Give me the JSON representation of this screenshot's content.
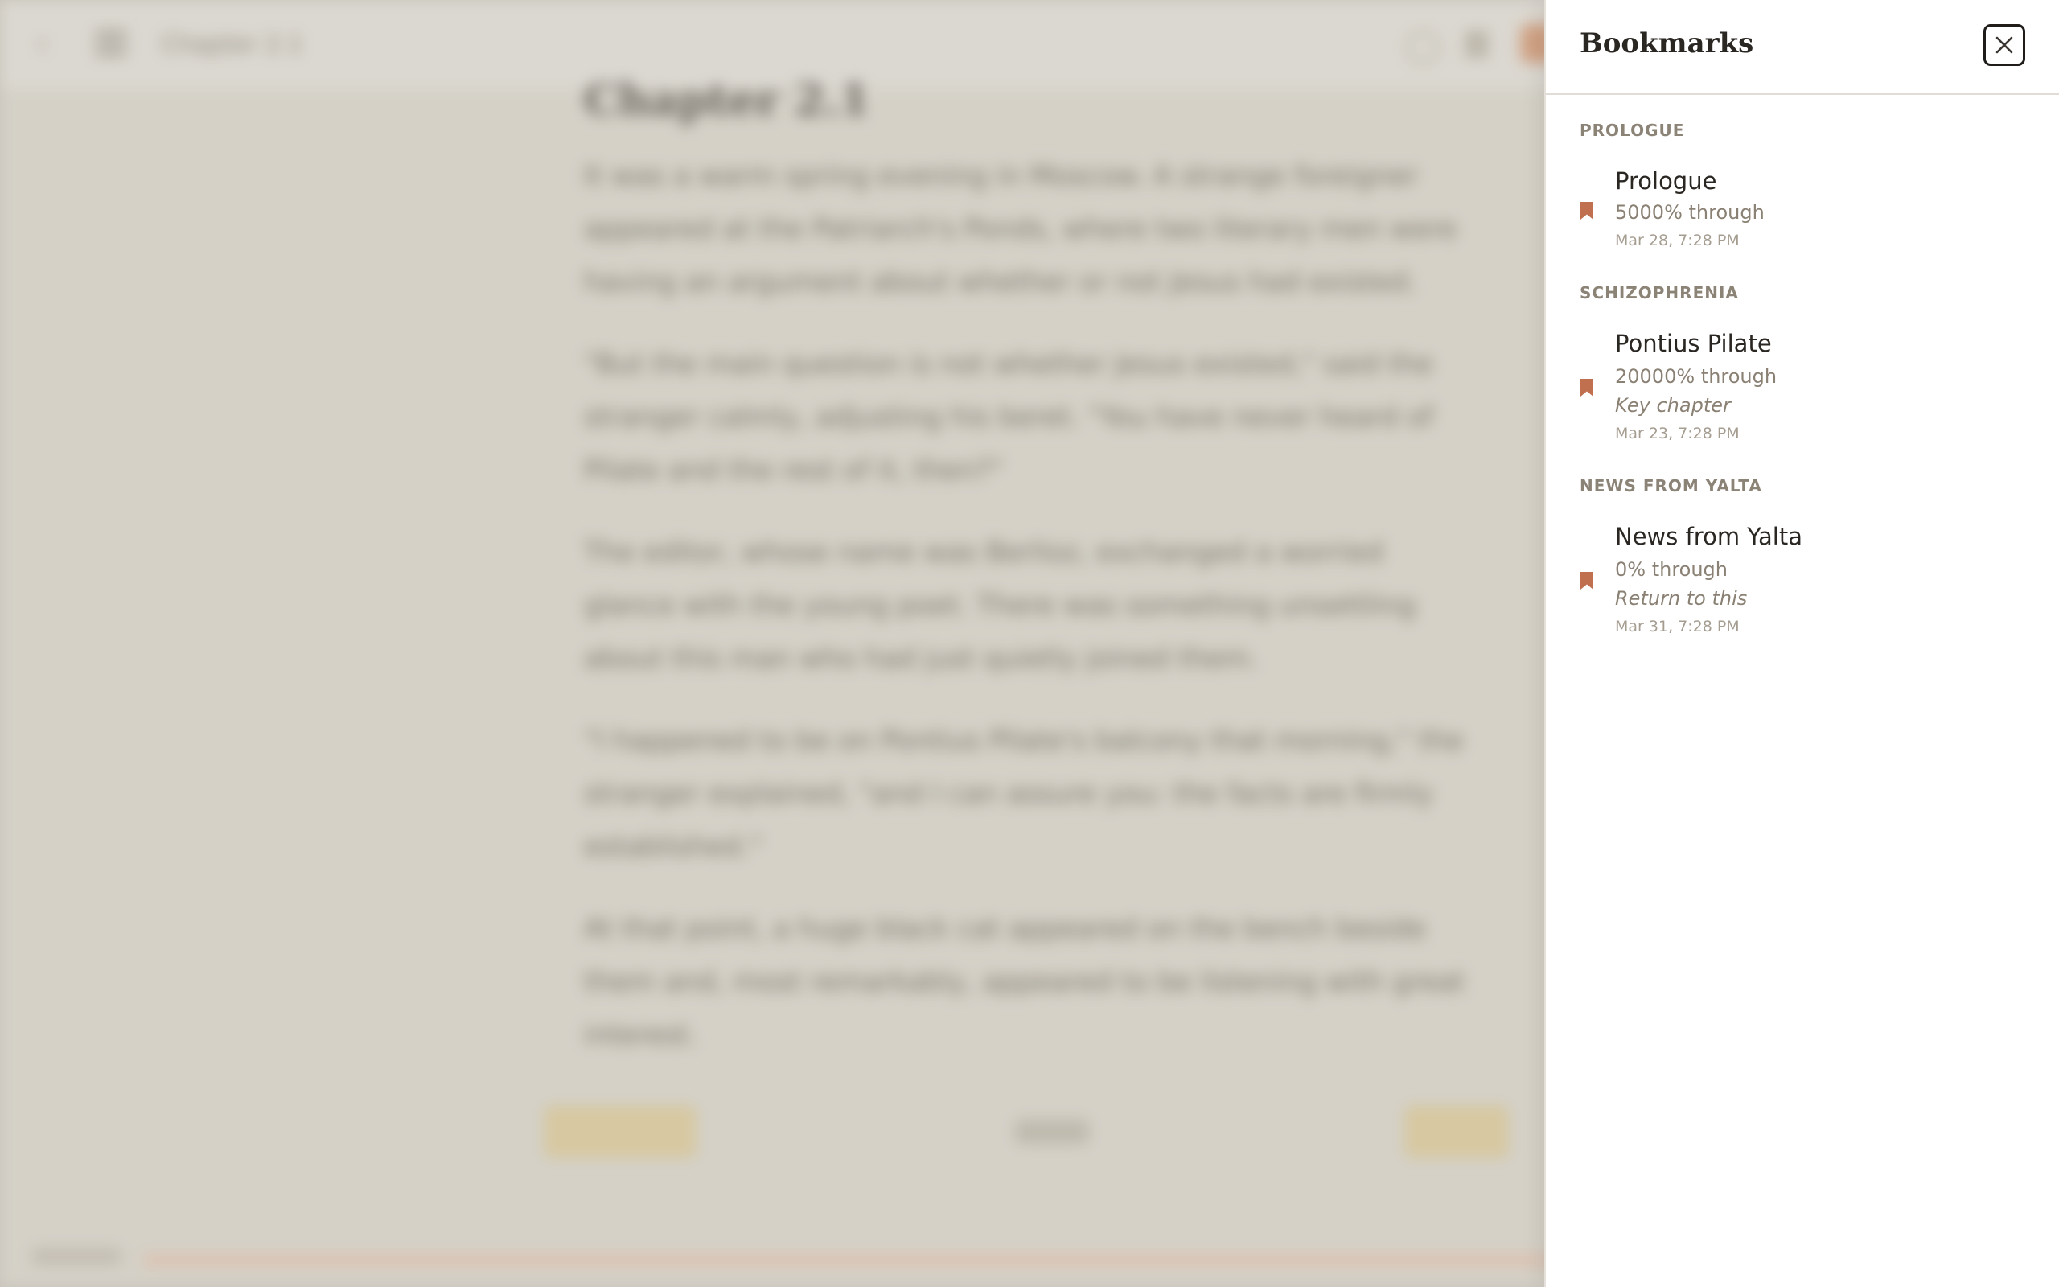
{
  "reader": {
    "top_title": "Chapter 2.1",
    "chapter_heading": "Chapter 2.1",
    "paragraphs": [
      "It was a warm spring evening in Moscow. A strange foreigner appeared at the Patriarch's Ponds, where two literary men were having an argument about whether or not Jesus had existed.",
      "\"But the main question is not whether Jesus existed,\" said the stranger calmly, adjusting his beret. \"You have never heard of Pilate and the rest of it, then?\"",
      "The editor, whose name was Berlioz, exchanged a worried glance with the young poet. There was something unsettling about this man who had just quietly joined them.",
      "\"I happened to be on Pontius Pilate's balcony that morning,\" the stranger explained, \"and I can assure you: the facts are firmly established.\"",
      "At that point, a huge black cat appeared on the bench beside them and, most remarkably, appeared to be listening with great interest."
    ],
    "prev_label": "← Previous",
    "page_indicator": "1 / 12",
    "next_label": "Next →",
    "progress_label": "Progress 6%"
  },
  "drawer": {
    "title": "Bookmarks",
    "close_label": "Close bookmarks",
    "accent_color": "#c0704f",
    "groups": [
      {
        "label": "PROLOGUE",
        "items": [
          {
            "title": "Prologue",
            "progress": "5000% through",
            "note": "",
            "date": "Mar 28, 7:28 PM"
          }
        ]
      },
      {
        "label": "SCHIZOPHRENIA",
        "items": [
          {
            "title": "Pontius Pilate",
            "progress": "20000% through",
            "note": "Key chapter",
            "date": "Mar 23, 7:28 PM"
          }
        ]
      },
      {
        "label": "NEWS FROM YALTA",
        "items": [
          {
            "title": "News from Yalta",
            "progress": "0% through",
            "note": "Return to this",
            "date": "Mar 31, 7:28 PM"
          }
        ]
      }
    ]
  }
}
